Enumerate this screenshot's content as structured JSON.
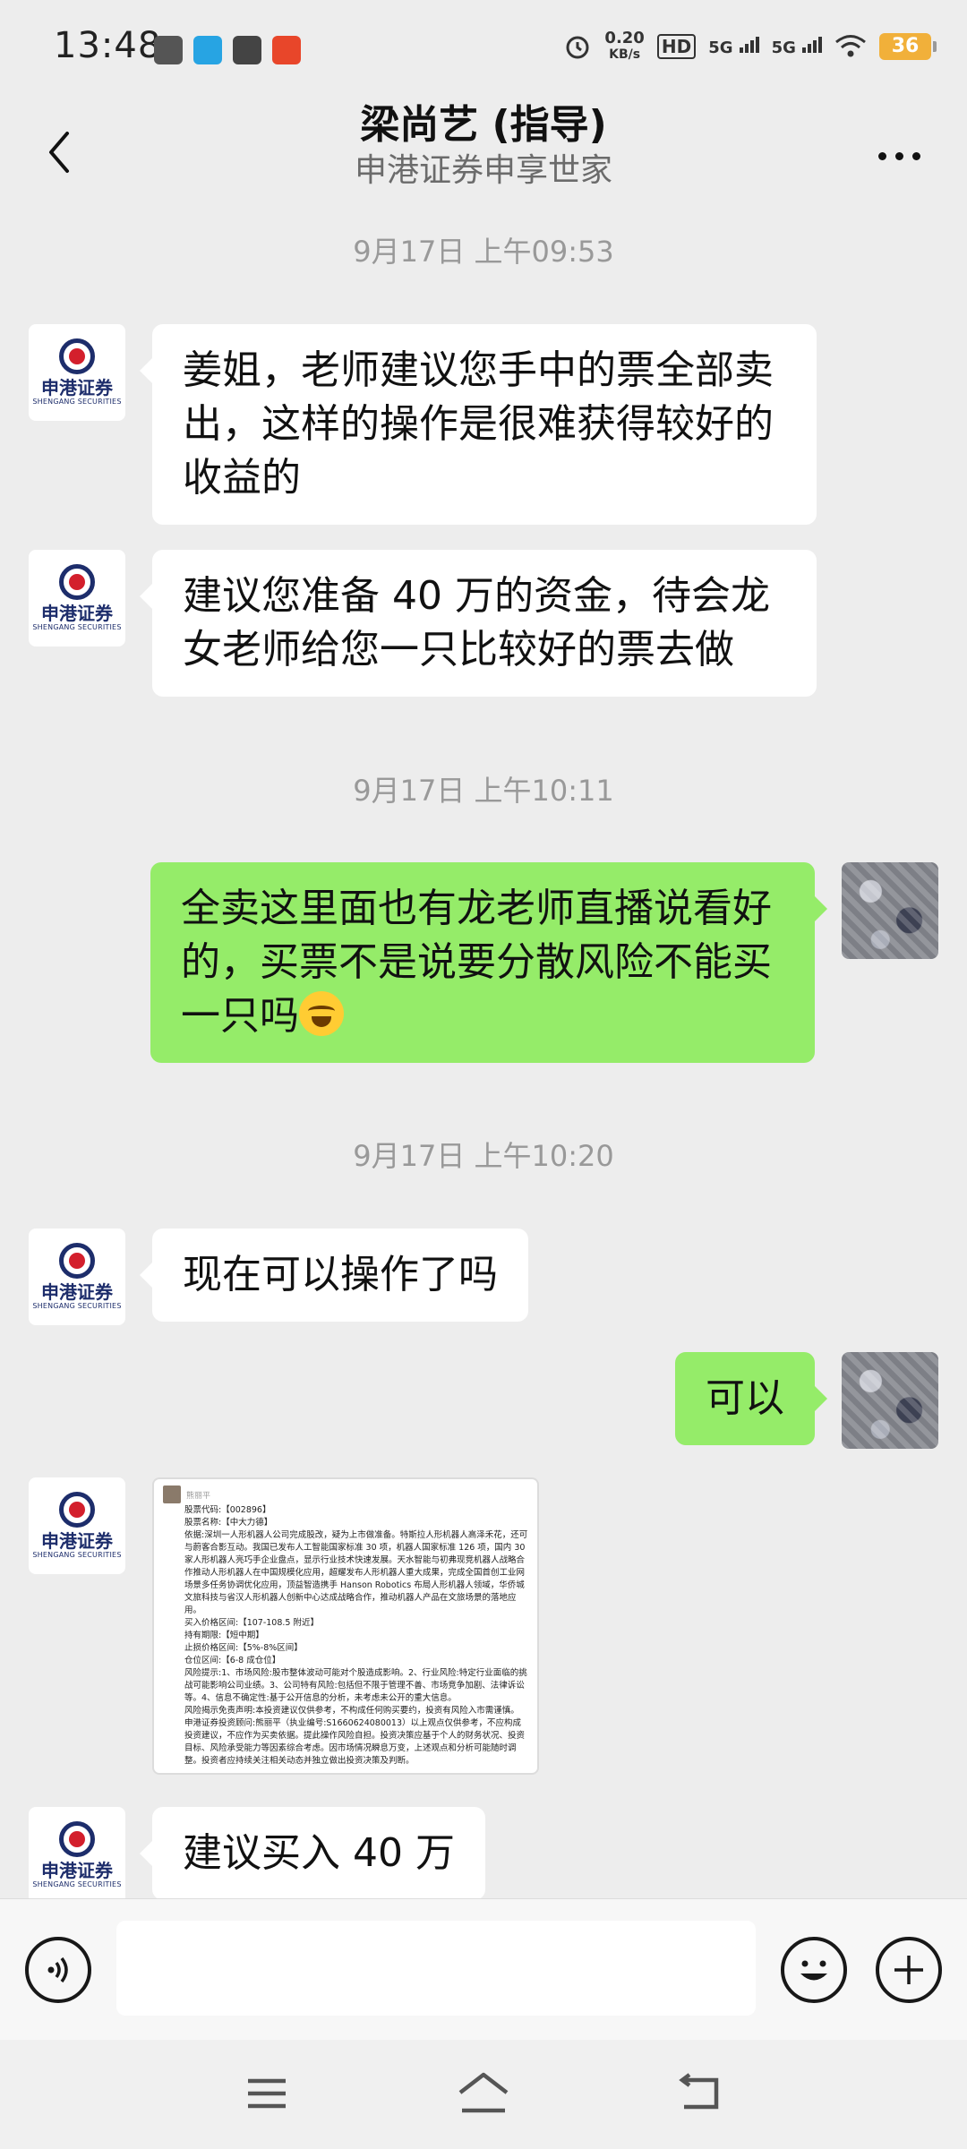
{
  "status_bar": {
    "time": "13:48",
    "net_speed_value": "0.20",
    "net_speed_unit": "KB/s",
    "hd_label": "HD",
    "sim1_label": "5G",
    "sim2_label": "5G",
    "battery": "36"
  },
  "header": {
    "title": "梁尚艺 (指导)",
    "subtitle": "申港证券申享世家"
  },
  "avatar_brand": {
    "name": "申港证券",
    "name_en": "SHENGANG SECURITIES"
  },
  "messages": {
    "ts1": "9月17日 上午09:53",
    "m1": "姜姐，老师建议您手中的票全部卖出，这样的操作是很难获得较好的收益的",
    "m2": "建议您准备 40 万的资金，待会龙女老师给您一只比较好的票去做",
    "ts2": "9月17日 上午10:11",
    "m3": "全卖这里面也有龙老师直播说看好的，买票不是说要分散风险不能买一只吗",
    "ts3": "9月17日 上午10:20",
    "m4": "现在可以操作了吗",
    "m5": "可以",
    "m7": "建议买入 40 万"
  },
  "shared_image": {
    "author": "熊丽平",
    "text": "股票代码:【002896】\n股票名称:【中大力德】\n依据:深圳一人形机器人公司完成股改，疑为上市做准备。特斯拉人形机器人高泽禾花，还可与蔚客合影互动。我国已发布人工智能国家标准 30 项，机器人国家标准 126 项，国内 30 家人形机器人亮巧手企业盘点，显示行业技术快速发展。天水智能与初弗现竞机器人战略合作推动人形机器人在中国规模化应用，超耀发布人形机器人重大成果，完成全国首创工业网场景多任务协调优化应用，顶益智造携手 Hanson Robotics 布局人形机器人领域，华侨城文旅科技与省汉人形机器人创新中心达成战略合作，推动机器人产品在文旅场景的落地应用。\n买入价格区间:【107-108.5 附近】\n持有期限:【短中期】\n止损价格区间:【5%-8%区间】\n仓位区间:【6-8 成仓位】\n风险提示:1、市场风险:股市整体波动可能对个股造成影响。2、行业风险:特定行业面临的挑战可能影响公司业绩。3、公司特有风险:包括但不限于管理不善、市场竞争加剧、法律诉讼等。4、信息不确定性:基于公开信息的分析，未考虑未公开的重大信息。\n风险揭示免责声明:本投资建议仅供参考，不构成任何购买要约，投资有风险入市需谨慎。\n申港证券投资顾问:熊丽平（执业编号:S1660624080013）以上观点仅供参考，不应构成投资建议，不应作为买卖依据。提此操作风险自担。投资决策应基于个人的财务状况、投资目标、风险承受能力等因素综合考虑。因市场情况瞬息万变，上述观点和分析可能随时调整。投资者应持续关注相关动态并独立做出投资决策及判断。"
  },
  "icons": {
    "back": "chevron-left-icon",
    "more": "more-dots-icon",
    "voice": "voice-icon",
    "emoji": "emoji-icon",
    "plus": "plus-icon",
    "menu": "menu-icon",
    "home": "home-icon",
    "back_nav": "back-icon"
  },
  "colors": {
    "chat_bg": "#ededed",
    "my_bubble": "#95ec69",
    "their_bubble": "#ffffff",
    "brand_red": "#d31f2c",
    "brand_navy": "#1d2d6b"
  }
}
